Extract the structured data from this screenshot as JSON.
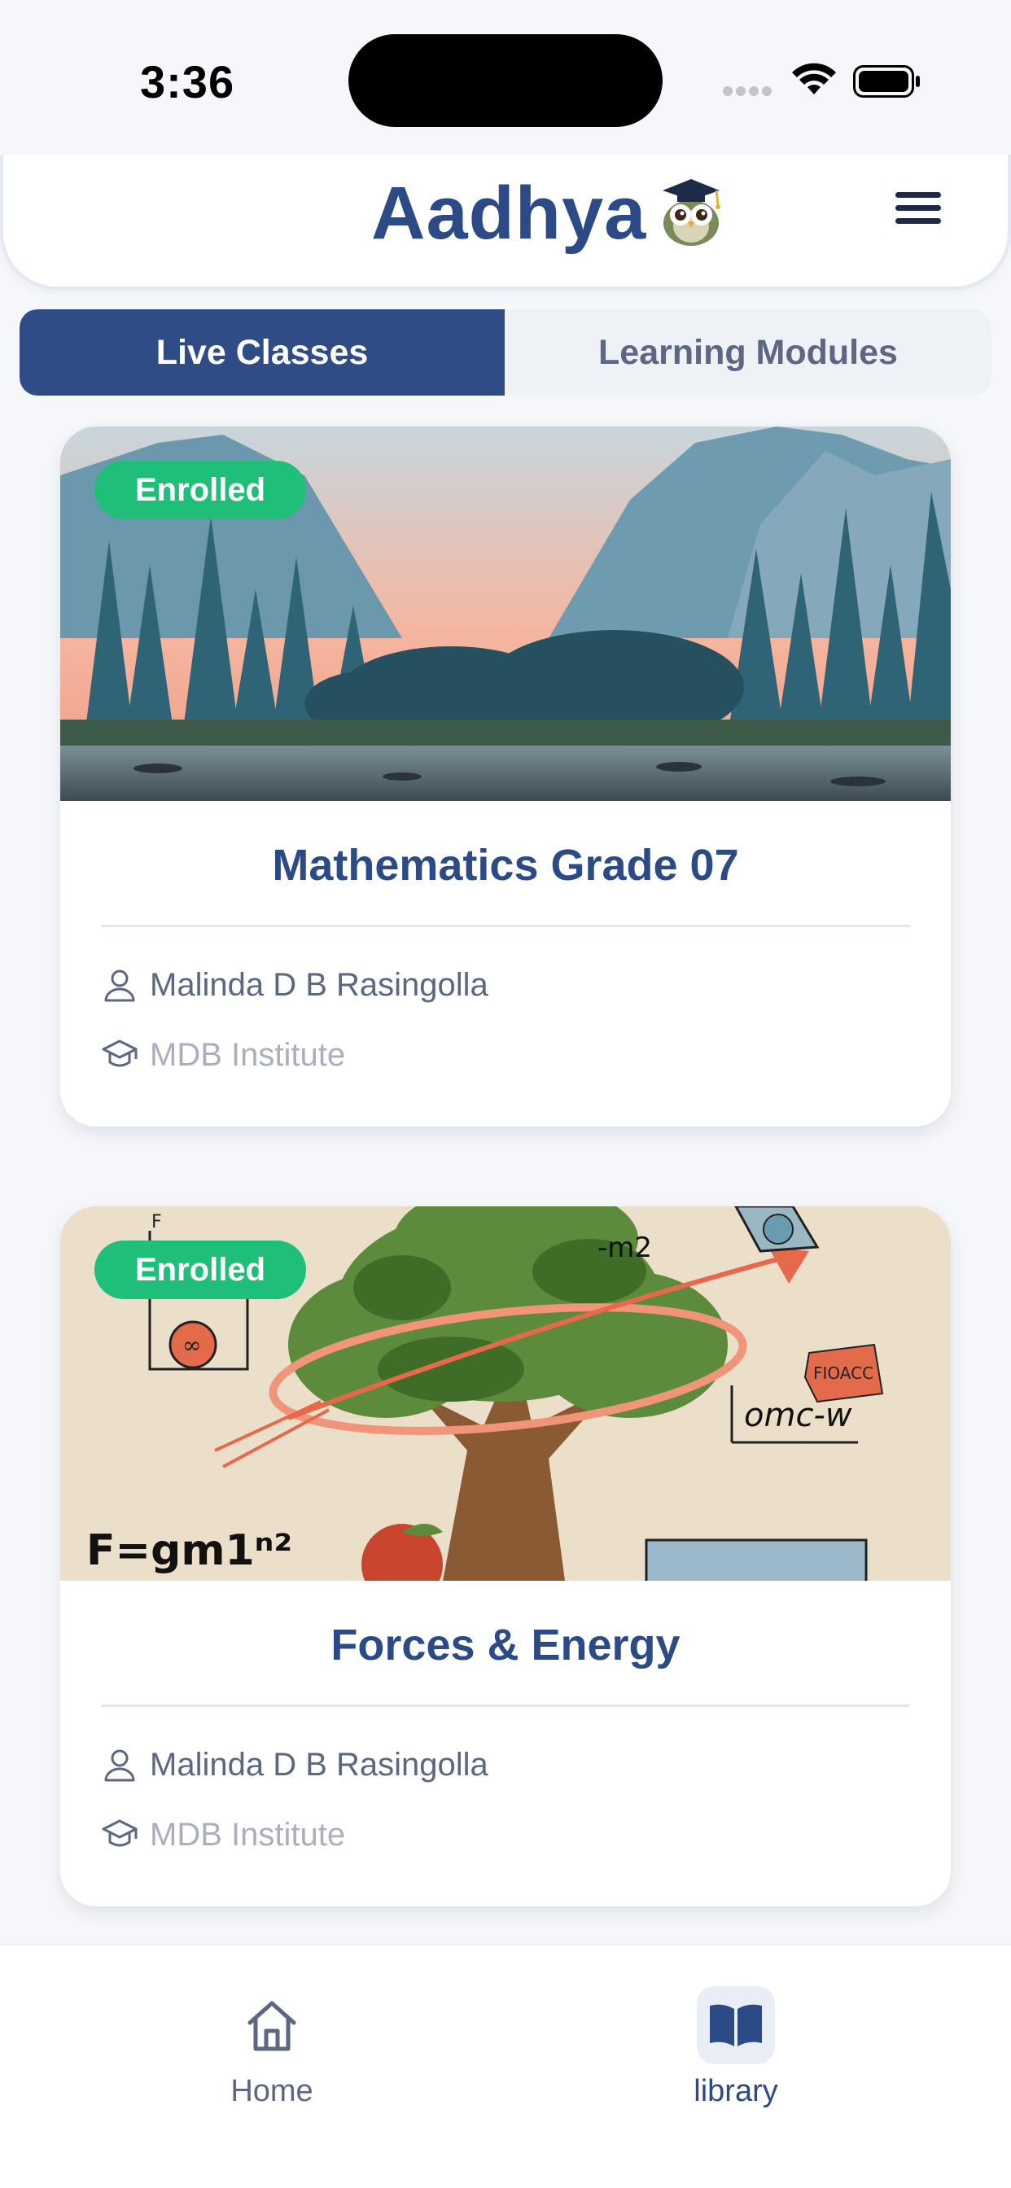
{
  "status_bar": {
    "time": "3:36"
  },
  "header": {
    "app_name": "Aadhya",
    "logo_icon": "owl-graduate-icon",
    "menu_icon": "hamburger-menu-icon"
  },
  "tabs": [
    {
      "label": "Live Classes",
      "active": true
    },
    {
      "label": "Learning Modules",
      "active": false
    }
  ],
  "courses": [
    {
      "badge": "Enrolled",
      "title": "Mathematics Grade 07",
      "teacher": "Malinda D B Rasingolla",
      "institute": "MDB Institute",
      "image": "mountain-lake-landscape"
    },
    {
      "badge": "Enrolled",
      "title": "Forces & Energy",
      "teacher": "Malinda D B Rasingolla",
      "institute": "MDB Institute",
      "image": "tree-physics-illustration",
      "image_text": {
        "formula": "F=gm1ⁿ²",
        "chalk": "omc-w",
        "box": "FIOACC",
        "top": "-m2"
      }
    }
  ],
  "bottom_nav": [
    {
      "label": "Home",
      "icon": "home-icon",
      "active": false
    },
    {
      "label": "library",
      "icon": "open-book-icon",
      "active": true
    }
  ],
  "colors": {
    "primary": "#2f4c86",
    "badge_green": "#1fbf7a",
    "background": "#f5f7fa",
    "muted_text": "#5b6783",
    "light_text": "#a9afbd"
  }
}
